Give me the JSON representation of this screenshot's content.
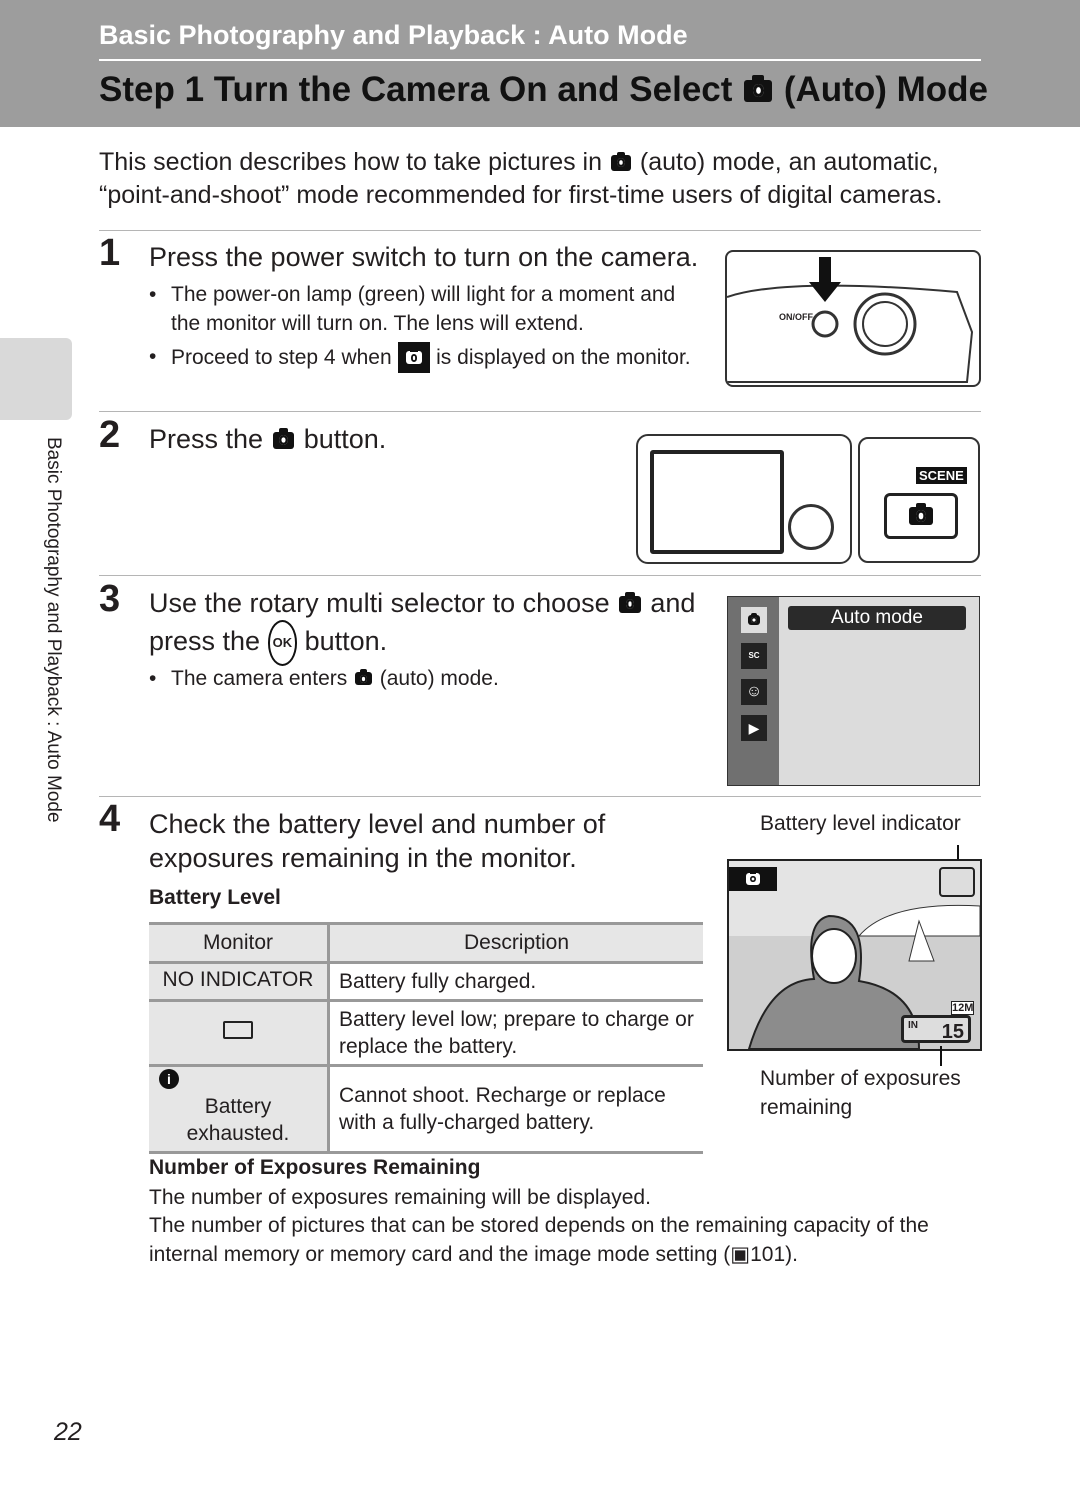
{
  "header": {
    "section": "Basic Photography and Playback : Auto Mode",
    "title_pre": "Step 1 Turn the Camera On and Select",
    "title_post": "(Auto) Mode",
    "icon": "camera-auto-icon"
  },
  "intro": {
    "pre": "This section describes how to take pictures in",
    "post": "(auto) mode, an automatic, “point-and-shoot” mode recommended for first-time users of digital cameras."
  },
  "sidebar": {
    "tab_text": "Basic Photography and Playback : Auto Mode"
  },
  "steps": [
    {
      "number": "1",
      "heading": "Press the power switch to turn on the camera.",
      "bullets": [
        "The power-on lamp (green) will light for a moment and the monitor will turn on. The lens will extend.",
        "Proceed to step 4 when",
        "is displayed on the monitor."
      ],
      "figure_label": "ON/OFF"
    },
    {
      "number": "2",
      "heading_pre": "Press the",
      "heading_post": "button.",
      "figure_label": "SCENE"
    },
    {
      "number": "3",
      "heading_pre": "Use the rotary multi selector to choose",
      "heading_mid": "and press the",
      "heading_post": "button.",
      "ok": "OK",
      "bullets_pre": "The camera enters",
      "bullets_post": "(auto) mode.",
      "menu_label": "Auto mode",
      "menu_icons": [
        "camera-auto-icon",
        "scene-icon",
        "smart-portrait-icon",
        "movie-icon"
      ]
    },
    {
      "number": "4",
      "heading": "Check the battery level and number of exposures remaining in the monitor.",
      "battery_heading": "Battery Level",
      "table": {
        "headers": [
          "Monitor",
          "Description"
        ],
        "rows": [
          {
            "monitor": "NO INDICATOR",
            "description": "Battery fully charged."
          },
          {
            "monitor_icon": "battery-low-icon",
            "description": "Battery level low; prepare to charge or replace the battery."
          },
          {
            "monitor_icon": "warning-icon",
            "monitor": "Battery exhausted.",
            "description": "Cannot shoot. Recharge or replace with a fully-charged battery."
          }
        ]
      },
      "callout_battery": "Battery level indicator",
      "callout_exposures": "Number of exposures remaining",
      "screen_size": "12M",
      "screen_mem": "IN",
      "screen_count": "15",
      "exposures_heading": "Number of Exposures Remaining",
      "exposures_text1": "The number of exposures remaining will be displayed.",
      "exposures_text2": "The number of pictures that can be stored depends on the remaining capacity of the internal memory or memory card and the image mode setting (",
      "exposures_ref": "101",
      "exposures_end": ")."
    }
  ],
  "page_number": "22"
}
